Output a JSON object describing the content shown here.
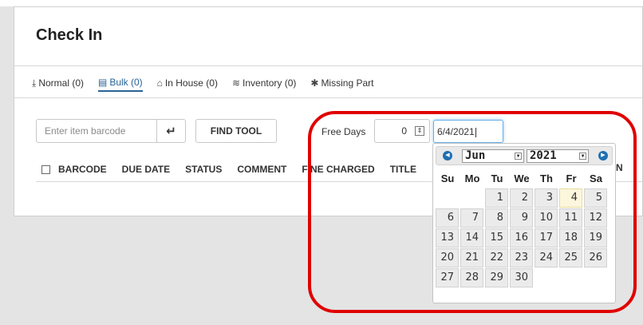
{
  "page": {
    "title": "Check In"
  },
  "tabs": [
    {
      "label": "Normal (0)",
      "icon": "download-icon",
      "active": false
    },
    {
      "label": "Bulk (0)",
      "icon": "barcode-list-icon",
      "active": true
    },
    {
      "label": "In House (0)",
      "icon": "home-icon",
      "active": false
    },
    {
      "label": "Inventory (0)",
      "icon": "layers-icon",
      "active": false
    },
    {
      "label": "Missing Part",
      "icon": "puzzle-icon",
      "active": false
    }
  ],
  "toolbar": {
    "barcode_placeholder": "Enter item barcode",
    "enter_icon": "enter-arrow-icon",
    "find_tool_label": "FIND TOOL",
    "free_days_label": "Free Days",
    "free_days_value": "0",
    "date_value": "6/4/2021"
  },
  "table": {
    "columns": [
      "BARCODE",
      "DUE DATE",
      "STATUS",
      "COMMENT",
      "FINE CHARGED",
      "TITLE"
    ],
    "partial_column_fragment": "N"
  },
  "calendar": {
    "month": "Jun",
    "year": "2021",
    "weekdays": [
      "Su",
      "Mo",
      "Tu",
      "We",
      "Th",
      "Fr",
      "Sa"
    ],
    "leading_blanks": 2,
    "days": [
      "1",
      "2",
      "3",
      "4",
      "5",
      "6",
      "7",
      "8",
      "9",
      "10",
      "11",
      "12",
      "13",
      "14",
      "15",
      "16",
      "17",
      "18",
      "19",
      "20",
      "21",
      "22",
      "23",
      "24",
      "25",
      "26",
      "27",
      "28",
      "29",
      "30"
    ],
    "highlighted_day": "4"
  },
  "colors": {
    "active_tab": "#2a6496",
    "callout": "#e00000",
    "nav_button": "#1f6fb2",
    "highlight_day": "#fbf6dc"
  }
}
